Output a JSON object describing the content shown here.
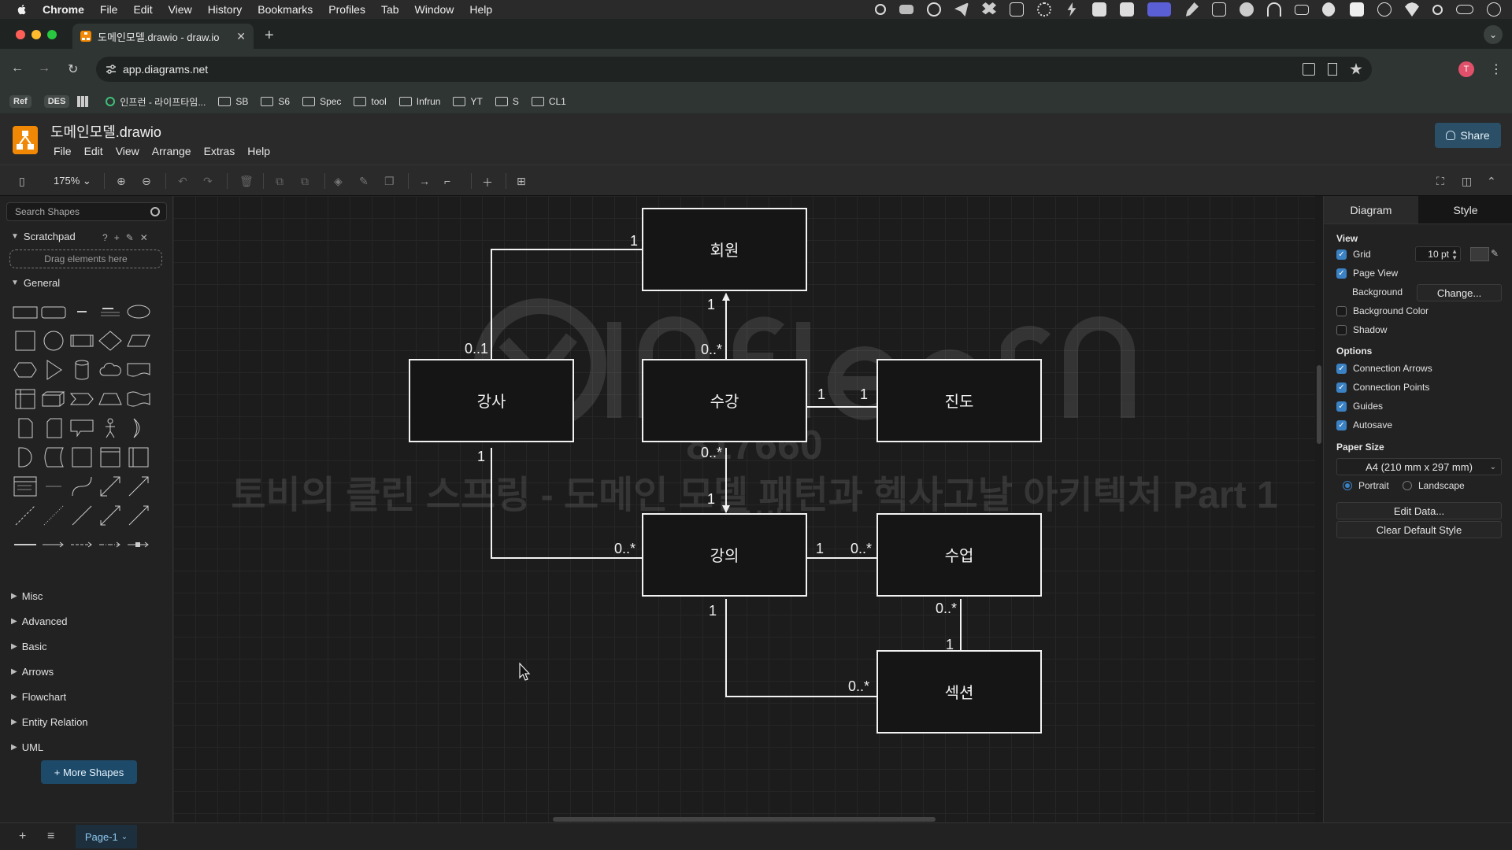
{
  "mac_menubar": {
    "items": [
      "Chrome",
      "File",
      "Edit",
      "View",
      "History",
      "Bookmarks",
      "Profiles",
      "Tab",
      "Window",
      "Help"
    ]
  },
  "browser": {
    "tab_title": "도메인모델.drawio - draw.io",
    "url": "app.diagrams.net",
    "bookmarks": [
      {
        "label": "Ref",
        "type": "badge"
      },
      {
        "label": "DES",
        "type": "badge"
      },
      {
        "label": "인프런 - 라이프타임...",
        "type": "link"
      },
      {
        "label": "SB",
        "type": "folder"
      },
      {
        "label": "S6",
        "type": "folder"
      },
      {
        "label": "Spec",
        "type": "folder"
      },
      {
        "label": "tool",
        "type": "folder"
      },
      {
        "label": "Infrun",
        "type": "folder"
      },
      {
        "label": "YT",
        "type": "folder"
      },
      {
        "label": "S",
        "type": "folder"
      },
      {
        "label": "CL1",
        "type": "folder"
      }
    ],
    "profile_initial": "T"
  },
  "drawio": {
    "doc_title": "도메인모델.drawio",
    "menu": [
      "File",
      "Edit",
      "View",
      "Arrange",
      "Extras",
      "Help"
    ],
    "share_label": "Share",
    "zoom": "175%",
    "search_placeholder": "Search Shapes",
    "scratchpad_label": "Scratchpad",
    "dropzone_label": "Drag elements here",
    "general_label": "General",
    "libraries": [
      "Misc",
      "Advanced",
      "Basic",
      "Arrows",
      "Flowchart",
      "Entity Relation",
      "UML"
    ],
    "more_shapes_label": "+ More Shapes",
    "page_tab": "Page-1",
    "panel": {
      "tabs": [
        "Diagram",
        "Style"
      ],
      "view_label": "View",
      "grid_label": "Grid",
      "grid_size": "10 pt",
      "page_view_label": "Page View",
      "background_label": "Background",
      "change_label": "Change...",
      "background_color_label": "Background Color",
      "shadow_label": "Shadow",
      "options_label": "Options",
      "options": [
        {
          "label": "Connection Arrows",
          "checked": true
        },
        {
          "label": "Connection Points",
          "checked": true
        },
        {
          "label": "Guides",
          "checked": true
        },
        {
          "label": "Autosave",
          "checked": true
        }
      ],
      "paper_size_label": "Paper Size",
      "paper_size": "A4 (210 mm x 297 mm)",
      "portrait_label": "Portrait",
      "landscape_label": "Landscape",
      "edit_data_label": "Edit Data...",
      "clear_style_label": "Clear Default Style"
    }
  },
  "diagram": {
    "entities": {
      "member": "회원",
      "instructor": "강사",
      "enrollment": "수강",
      "progress": "진도",
      "course": "강의",
      "lesson": "수업",
      "section": "섹션"
    },
    "labels": {
      "member_instructor_member": "1",
      "member_instructor_instructor": "0..1",
      "member_enroll_member": "1",
      "member_enroll_enroll": "0..*",
      "enroll_progress_enroll": "1",
      "enroll_progress_progress": "1",
      "enroll_course_enroll": "0..*",
      "enroll_course_course": "1",
      "instructor_course_instructor": "1",
      "instructor_course_course": "0..*",
      "course_lesson_course": "1",
      "course_lesson_lesson": "0..*",
      "lesson_section_lesson": "0..*",
      "lesson_section_section": "1",
      "course_section_course": "1",
      "course_section_section": "0..*"
    },
    "watermark": {
      "id": "817660",
      "title": "토비의 클린 스프링 - 도메인 모델 패턴과 헥사고날 아키텍처 Part 1",
      "author": "토비"
    }
  }
}
